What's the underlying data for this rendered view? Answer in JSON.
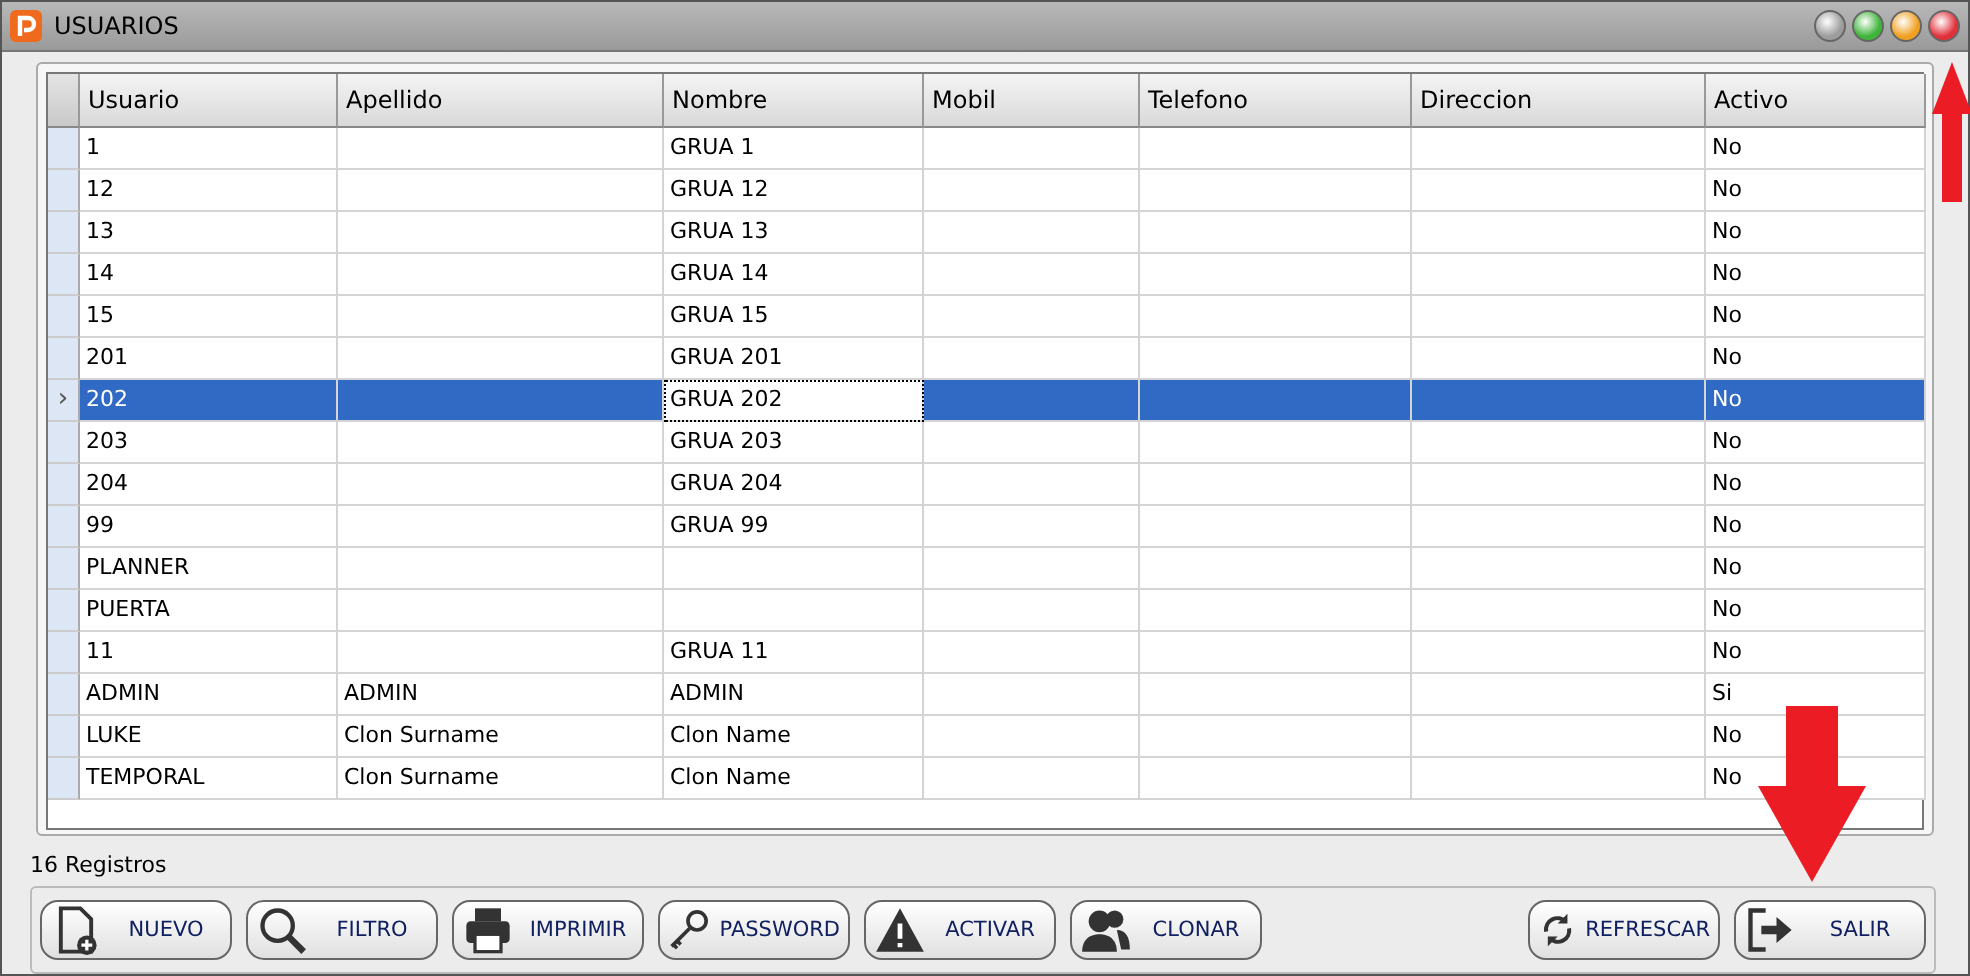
{
  "window": {
    "title": "USUARIOS"
  },
  "table": {
    "columns": [
      "Usuario",
      "Apellido",
      "Nombre",
      "Mobil",
      "Telefono",
      "Direccion",
      "Activo"
    ],
    "rows": [
      {
        "selected": false,
        "cells": [
          "1",
          "",
          "GRUA 1",
          "",
          "",
          "",
          "No"
        ]
      },
      {
        "selected": false,
        "cells": [
          "12",
          "",
          "GRUA 12",
          "",
          "",
          "",
          "No"
        ]
      },
      {
        "selected": false,
        "cells": [
          "13",
          "",
          "GRUA 13",
          "",
          "",
          "",
          "No"
        ]
      },
      {
        "selected": false,
        "cells": [
          "14",
          "",
          "GRUA 14",
          "",
          "",
          "",
          "No"
        ]
      },
      {
        "selected": false,
        "cells": [
          "15",
          "",
          "GRUA 15",
          "",
          "",
          "",
          "No"
        ]
      },
      {
        "selected": false,
        "cells": [
          "201",
          "",
          "GRUA 201",
          "",
          "",
          "",
          "No"
        ]
      },
      {
        "selected": true,
        "indicator": "›",
        "cells": [
          "202",
          "",
          "GRUA 202",
          "",
          "",
          "",
          "No"
        ]
      },
      {
        "selected": false,
        "cells": [
          "203",
          "",
          "GRUA 203",
          "",
          "",
          "",
          "No"
        ]
      },
      {
        "selected": false,
        "cells": [
          "204",
          "",
          "GRUA 204",
          "",
          "",
          "",
          "No"
        ]
      },
      {
        "selected": false,
        "cells": [
          "99",
          "",
          "GRUA 99",
          "",
          "",
          "",
          "No"
        ]
      },
      {
        "selected": false,
        "cells": [
          "PLANNER",
          "",
          "",
          "",
          "",
          "",
          "No"
        ]
      },
      {
        "selected": false,
        "cells": [
          "PUERTA",
          "",
          "",
          "",
          "",
          "",
          "No"
        ]
      },
      {
        "selected": false,
        "cells": [
          "11",
          "",
          "GRUA 11",
          "",
          "",
          "",
          "No"
        ]
      },
      {
        "selected": false,
        "cells": [
          "ADMIN",
          "ADMIN",
          "ADMIN",
          "",
          "",
          "",
          "Si"
        ]
      },
      {
        "selected": false,
        "cells": [
          "LUKE",
          "Clon Surname",
          "Clon Name",
          "",
          "",
          "",
          "No"
        ]
      },
      {
        "selected": false,
        "cells": [
          "TEMPORAL",
          "Clon Surname",
          "Clon Name",
          "",
          "",
          "",
          "No"
        ]
      }
    ]
  },
  "status": "16 Registros",
  "buttons_left": [
    {
      "label": "NUEVO",
      "kind": "new"
    },
    {
      "label": "FILTRO",
      "kind": "search"
    },
    {
      "label": "IMPRIMIR",
      "kind": "print"
    },
    {
      "label": "PASSWORD",
      "kind": "key"
    },
    {
      "label": "ACTIVAR",
      "kind": "warning"
    },
    {
      "label": "CLONAR",
      "kind": "users"
    }
  ],
  "buttons_right": [
    {
      "label": "REFRESCAR",
      "kind": "refresh"
    },
    {
      "label": "SALIR",
      "kind": "exit"
    }
  ]
}
